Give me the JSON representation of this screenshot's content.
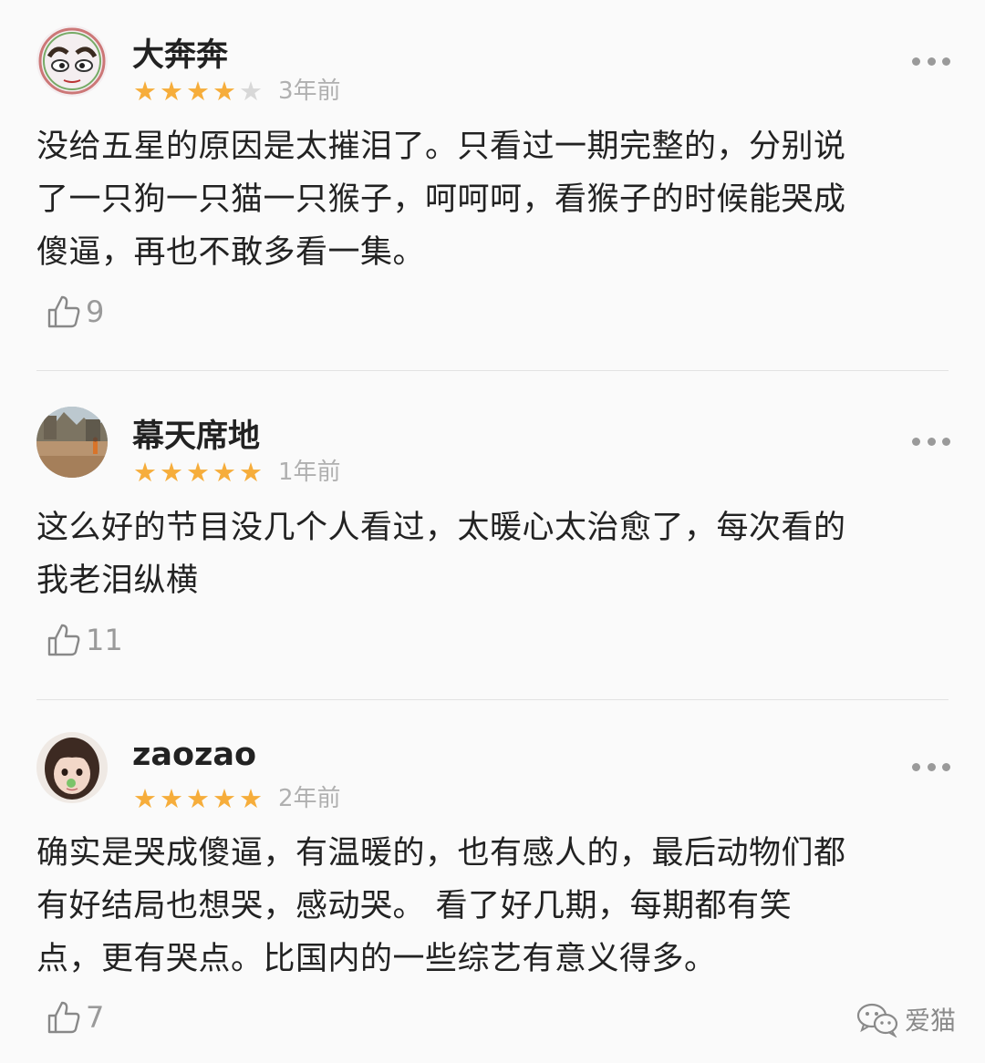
{
  "reviews": [
    {
      "username": "大奔奔",
      "avatar_icon": "cartoon-eyes-avatar",
      "rating": 4,
      "max_rating": 5,
      "time": "3年前",
      "content_lines": [
        "没给五星的原因是太摧泪了。只看过一期完整的，分别说",
        "了一只狗一只猫一只猴子，呵呵呵，看猴子的时候能哭成",
        "傻逼，再也不敢多看一集。"
      ],
      "likes": "9"
    },
    {
      "username": "幕天席地",
      "avatar_icon": "landscape-photo-avatar",
      "rating": 5,
      "max_rating": 5,
      "time": "1年前",
      "content_lines": [
        "这么好的节目没几个人看过，太暖心太治愈了，每次看的",
        "我老泪纵横"
      ],
      "likes": "11"
    },
    {
      "username": "zaozao",
      "avatar_icon": "girl-photo-avatar",
      "rating": 5,
      "max_rating": 5,
      "time": "2年前",
      "content_lines": [
        "确实是哭成傻逼，有温暖的，也有感人的，最后动物们都",
        "有好结局也想哭，感动哭。 看了好几期，每期都有笑",
        "点，更有哭点。比国内的一些综艺有意义得多。"
      ],
      "likes": "7"
    }
  ],
  "icons": {
    "more": "more-dots-icon",
    "like": "thumbs-up-icon",
    "star": "star-icon"
  },
  "colors": {
    "star_on": "#f6ad3b",
    "star_off": "#d8d8d8",
    "muted_text": "#b0b0b0",
    "body_text": "#222222"
  },
  "watermark": {
    "text": "爱猫",
    "icon": "wechat-icon"
  }
}
